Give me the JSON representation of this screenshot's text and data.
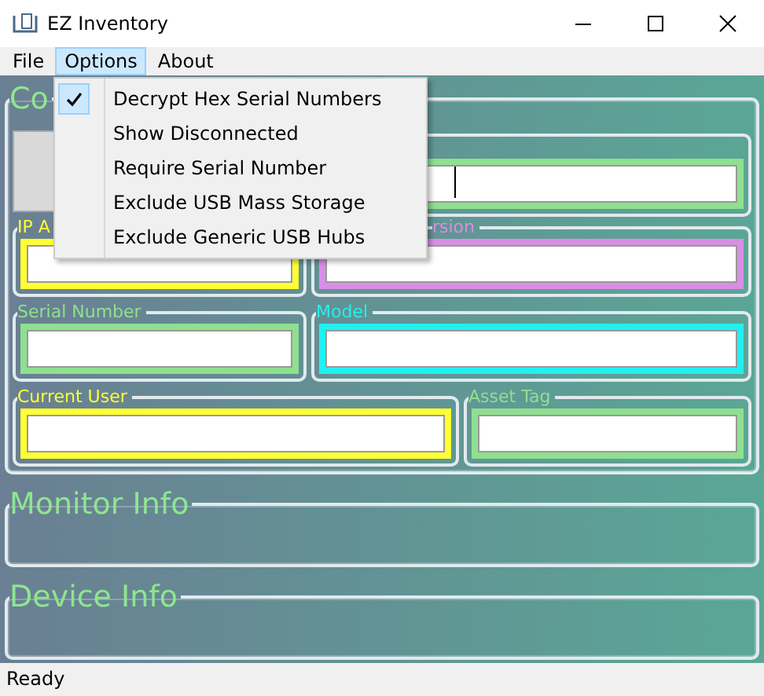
{
  "window": {
    "title": "EZ Inventory"
  },
  "menu_bar": [
    {
      "label": "File",
      "selected": false
    },
    {
      "label": "Options",
      "selected": true
    },
    {
      "label": "About",
      "selected": false
    }
  ],
  "dropdown": {
    "items": [
      {
        "label": "Decrypt Hex Serial Numbers",
        "checked": true
      },
      {
        "label": "Show Disconnected",
        "checked": false
      },
      {
        "label": "Require Serial Number",
        "checked": false
      },
      {
        "label": "Exclude USB Mass Storage",
        "checked": false
      },
      {
        "label": "Exclude Generic USB Hubs",
        "checked": false
      }
    ]
  },
  "sections": [
    {
      "title": "Co",
      "rows": [
        [
          {
            "kind": "panel"
          },
          {
            "kind": "field",
            "color": "#8fe08f",
            "focused": true
          }
        ],
        [
          {
            "kind": "field",
            "label": "IP A",
            "color": "#ffff33",
            "focused": false
          },
          {
            "kind": "field",
            "label": "rsion",
            "color": "#d98ee6",
            "focused": false
          }
        ],
        [
          {
            "kind": "field",
            "label": "Serial Number",
            "color": "#8fe08f",
            "focused": false
          },
          {
            "kind": "field",
            "label": "Model",
            "color": "#22f0f0",
            "focused": false
          }
        ],
        [
          {
            "kind": "field",
            "label": "Current User",
            "color": "#ffff33",
            "focused": false
          },
          {
            "kind": "field",
            "label": "Asset Tag",
            "color": "#8fe08f",
            "focused": false
          }
        ]
      ]
    },
    {
      "title": "Monitor Info"
    },
    {
      "title": "Device Info"
    }
  ],
  "status_bar": "Ready"
}
